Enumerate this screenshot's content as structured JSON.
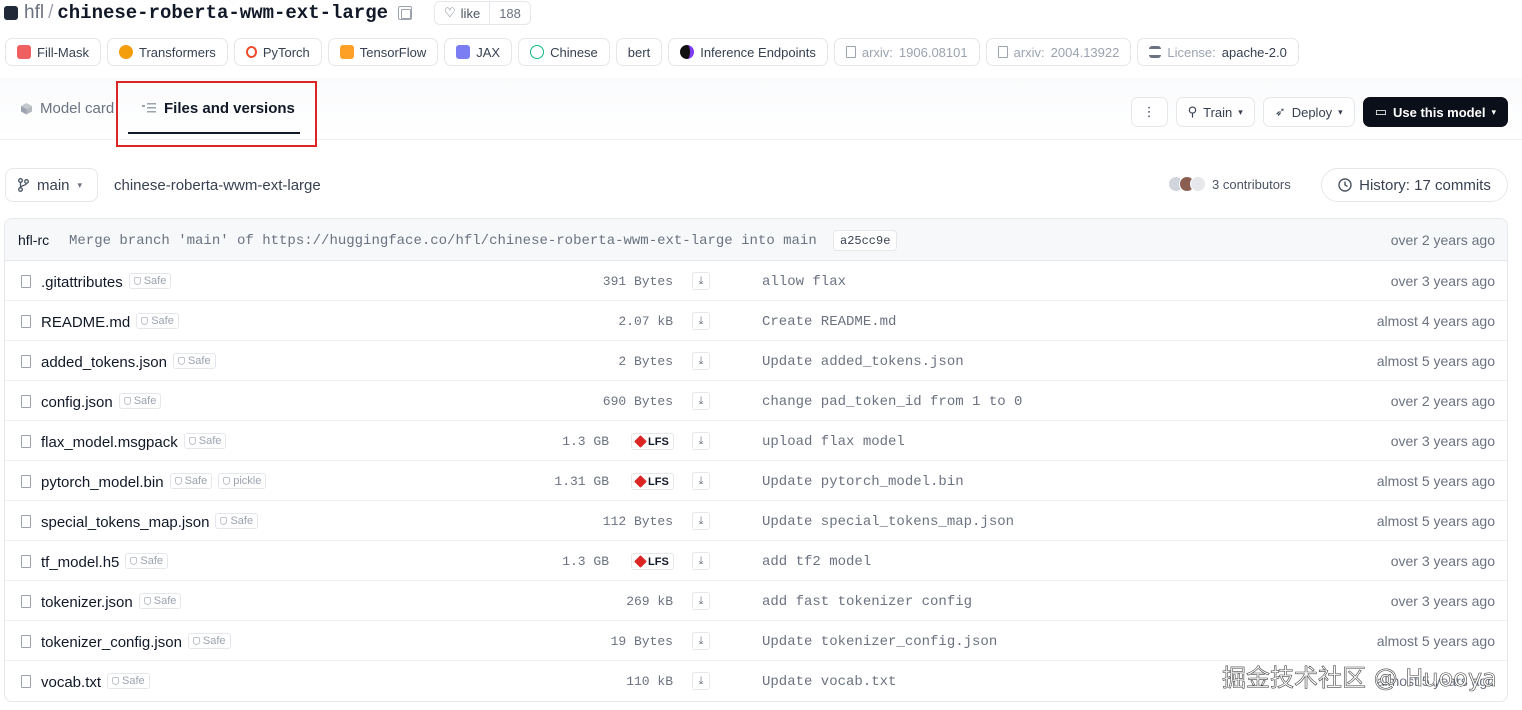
{
  "header": {
    "org": "hfl",
    "separator": "/",
    "repo": "chinese-roberta-wwm-ext-large",
    "like_label": "like",
    "like_count": "188"
  },
  "tags": [
    {
      "label": "Fill-Mask",
      "icon": "fill-mask-icon",
      "color": "#ef4444"
    },
    {
      "label": "Transformers",
      "icon": "hugging-face-icon",
      "color": "#f59e0b"
    },
    {
      "label": "PyTorch",
      "icon": "pytorch-icon",
      "color": "#ee4c2c"
    },
    {
      "label": "TensorFlow",
      "icon": "tensorflow-icon",
      "color": "#ff8f00"
    },
    {
      "label": "JAX",
      "icon": "jax-icon",
      "color": "#6366f1"
    },
    {
      "label": "Chinese",
      "icon": "globe-icon",
      "color": "#10b981"
    },
    {
      "label": "bert",
      "icon": "",
      "color": ""
    },
    {
      "label": "Inference Endpoints",
      "icon": "inference-endpoints-icon",
      "color": "#7c3aed"
    },
    {
      "prefix": "arxiv:",
      "label": "1906.08101",
      "icon": "paper-icon",
      "color": "#9ca3af"
    },
    {
      "prefix": "arxiv:",
      "label": "2004.13922",
      "icon": "paper-icon",
      "color": "#9ca3af"
    },
    {
      "prefix": "License: ",
      "label": "apache-2.0",
      "icon": "bank-icon",
      "color": "#6b7280"
    }
  ],
  "tabs": {
    "model_card": "Model card",
    "files": "Files and versions"
  },
  "actions": {
    "more": "⋮",
    "train": "Train",
    "deploy": "Deploy",
    "use": "Use this model"
  },
  "branch": {
    "name": "main",
    "path": "chinese-roberta-wwm-ext-large",
    "contributors": "3 contributors",
    "history": "History: 17 commits"
  },
  "last_commit": {
    "author": "hfl-rc",
    "message": "Merge branch 'main' of https://huggingface.co/hfl/chinese-roberta-wwm-ext-large into main",
    "hash": "a25cc9e",
    "time": "over 2 years ago"
  },
  "files": [
    {
      "name": ".gitattributes",
      "badges": [
        "Safe"
      ],
      "size": "391 Bytes",
      "lfs": false,
      "commit": "allow flax",
      "time": "over 3 years ago"
    },
    {
      "name": "README.md",
      "badges": [
        "Safe"
      ],
      "size": "2.07 kB",
      "lfs": false,
      "commit": "Create README.md",
      "time": "almost 4 years ago"
    },
    {
      "name": "added_tokens.json",
      "badges": [
        "Safe"
      ],
      "size": "2 Bytes",
      "lfs": false,
      "commit": "Update added_tokens.json",
      "time": "almost 5 years ago"
    },
    {
      "name": "config.json",
      "badges": [
        "Safe"
      ],
      "size": "690 Bytes",
      "lfs": false,
      "commit": "change pad_token_id from 1 to 0",
      "time": "over 2 years ago"
    },
    {
      "name": "flax_model.msgpack",
      "badges": [
        "Safe"
      ],
      "size": "1.3 GB",
      "lfs": true,
      "commit": "upload flax model",
      "time": "over 3 years ago"
    },
    {
      "name": "pytorch_model.bin",
      "badges": [
        "Safe",
        "pickle"
      ],
      "size": "1.31 GB",
      "lfs": true,
      "commit": "Update pytorch_model.bin",
      "time": "almost 5 years ago"
    },
    {
      "name": "special_tokens_map.json",
      "badges": [
        "Safe"
      ],
      "size": "112 Bytes",
      "lfs": false,
      "commit": "Update special_tokens_map.json",
      "time": "almost 5 years ago"
    },
    {
      "name": "tf_model.h5",
      "badges": [
        "Safe"
      ],
      "size": "1.3 GB",
      "lfs": true,
      "commit": "add tf2 model",
      "time": "over 3 years ago"
    },
    {
      "name": "tokenizer.json",
      "badges": [
        "Safe"
      ],
      "size": "269 kB",
      "lfs": false,
      "commit": "add fast tokenizer config",
      "time": "over 3 years ago"
    },
    {
      "name": "tokenizer_config.json",
      "badges": [
        "Safe"
      ],
      "size": "19 Bytes",
      "lfs": false,
      "commit": "Update tokenizer_config.json",
      "time": "almost 5 years ago"
    },
    {
      "name": "vocab.txt",
      "badges": [
        "Safe"
      ],
      "size": "110 kB",
      "lfs": false,
      "commit": "Update vocab.txt",
      "time": "almost 5 years ago"
    }
  ],
  "lfs_label": "LFS",
  "watermark": "掘金技术社区 @ Huooya",
  "colors": {
    "highlight": "#dc2626",
    "primary_button": "#0b0f19"
  }
}
